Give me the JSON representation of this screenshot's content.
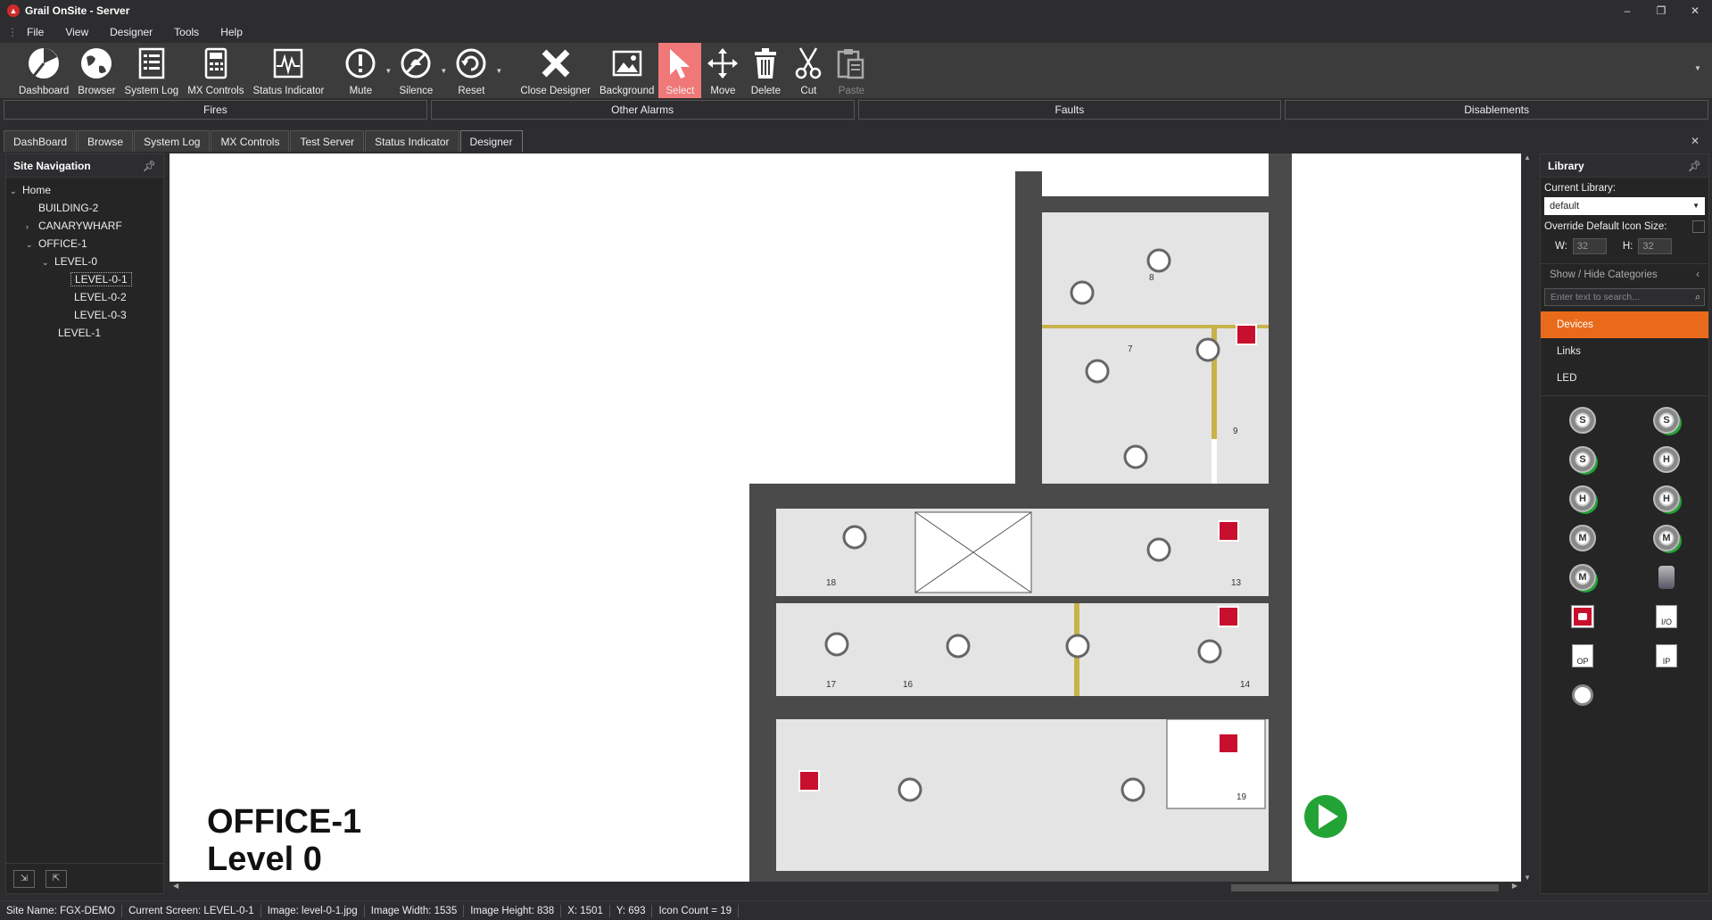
{
  "window": {
    "title": "Grail OnSite - Server",
    "minimize": "–",
    "restore": "❐",
    "close": "✕"
  },
  "menu": [
    "File",
    "View",
    "Designer",
    "Tools",
    "Help"
  ],
  "toolbar": {
    "dashboard": "Dashboard",
    "browser": "Browser",
    "system_log": "System Log",
    "mx_controls": "MX Controls",
    "status_indicator": "Status Indicator",
    "mute": "Mute",
    "silence": "Silence",
    "reset": "Reset",
    "close_designer": "Close Designer",
    "background": "Background",
    "select": "Select",
    "move": "Move",
    "delete": "Delete",
    "cut": "Cut",
    "paste": "Paste"
  },
  "alarms": [
    "Fires",
    "Other Alarms",
    "Faults",
    "Disablements"
  ],
  "tabs": [
    "DashBoard",
    "Browse",
    "System Log",
    "MX Controls",
    "Test Server",
    "Status Indicator",
    "Designer"
  ],
  "site_nav": {
    "title": "Site Navigation",
    "items": [
      {
        "label": "Home",
        "arrow": "⌄"
      },
      {
        "label": "BUILDING-2",
        "arrow": ""
      },
      {
        "label": "CANARYWHARF",
        "arrow": "›"
      },
      {
        "label": "OFFICE-1",
        "arrow": "⌄"
      },
      {
        "label": "LEVEL-0",
        "arrow": "⌄"
      },
      {
        "label": "LEVEL-0-1",
        "arrow": ""
      },
      {
        "label": "LEVEL-0-2",
        "arrow": ""
      },
      {
        "label": "LEVEL-0-3",
        "arrow": ""
      },
      {
        "label": "LEVEL-1",
        "arrow": ""
      }
    ]
  },
  "floorplan": {
    "title_line1": "OFFICE-1",
    "title_line2": "Level 0",
    "rooms": [
      "8",
      "7",
      "9",
      "18",
      "13",
      "17",
      "16",
      "14",
      "19"
    ]
  },
  "library": {
    "title": "Library",
    "current_library_label": "Current Library:",
    "current_library": "default",
    "override_label": "Override Default Icon Size:",
    "w_label": "W:",
    "w_value": "32",
    "h_label": "H:",
    "h_value": "32",
    "categories_header": "Show / Hide Categories",
    "search_placeholder": "Enter text to search...",
    "categories": [
      "Devices",
      "Links",
      "LED"
    ]
  },
  "status": {
    "site_name": "Site Name: FGX-DEMO",
    "current_screen": "Current Screen: LEVEL-0-1",
    "image": "Image: level-0-1.jpg",
    "image_width": "Image Width: 1535",
    "image_height": "Image Height: 838",
    "x": "X: 1501",
    "y": "Y: 693",
    "icon_count": "Icon Count = 19"
  }
}
